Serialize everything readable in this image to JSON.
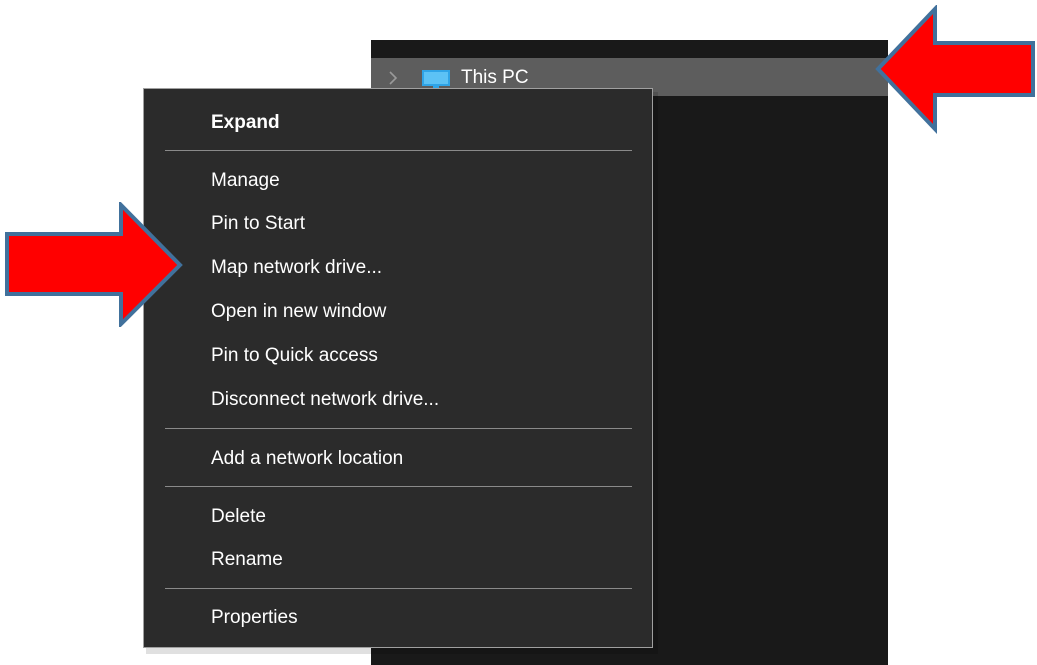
{
  "navigation_pane": {
    "this_pc_label": "This PC",
    "pc_icon": "monitor-icon",
    "chevron_icon": "chevron-right-icon"
  },
  "context_menu": {
    "items": [
      {
        "label": "Expand",
        "bold": true
      },
      {
        "label": "Manage"
      },
      {
        "label": "Pin to Start"
      },
      {
        "label": "Map network drive..."
      },
      {
        "label": "Open in new window"
      },
      {
        "label": "Pin to Quick access"
      },
      {
        "label": "Disconnect network drive..."
      },
      {
        "label": "Add a network location"
      },
      {
        "label": "Delete"
      },
      {
        "label": "Rename"
      },
      {
        "label": "Properties"
      }
    ]
  },
  "callouts": {
    "arrow_icon": "red-arrow-icon",
    "arrow_color": "#ff0000",
    "arrow_outline": "#41719c"
  },
  "colors": {
    "menu_background": "#2b2b2b",
    "pane_background": "#191919",
    "selected_row": "#5d5d5d",
    "menu_text": "#ffffff"
  }
}
